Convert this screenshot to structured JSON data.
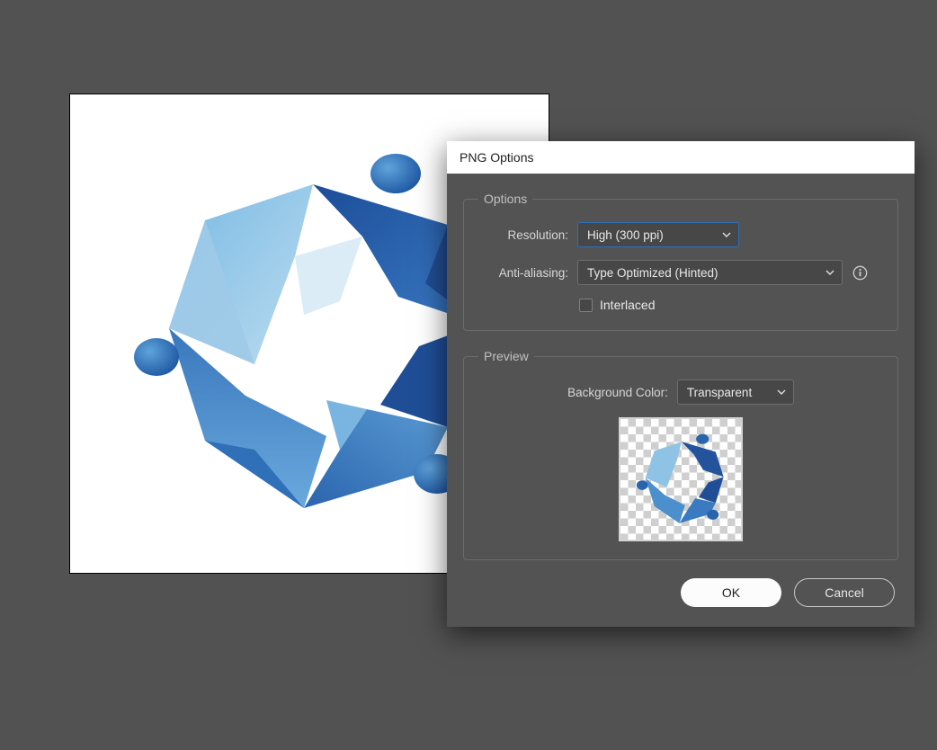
{
  "dialog": {
    "title": "PNG Options",
    "options_legend": "Options",
    "resolution_label": "Resolution:",
    "resolution_value": "High (300 ppi)",
    "antialias_label": "Anti-aliasing:",
    "antialias_value": "Type Optimized (Hinted)",
    "interlaced_label": "Interlaced",
    "interlaced_checked": false,
    "preview_legend": "Preview",
    "bgcolor_label": "Background Color:",
    "bgcolor_value": "Transparent",
    "ok_label": "OK",
    "cancel_label": "Cancel"
  },
  "icons": {
    "chevron": "chevron-down-icon",
    "info": "info-icon"
  },
  "artwork": {
    "description": "Abstract hexagonal blue logo with three orbiting dots",
    "palette": [
      "#1d4f9c",
      "#2d6bb7",
      "#4a90d0",
      "#72b5e0",
      "#a7d1eb"
    ]
  }
}
